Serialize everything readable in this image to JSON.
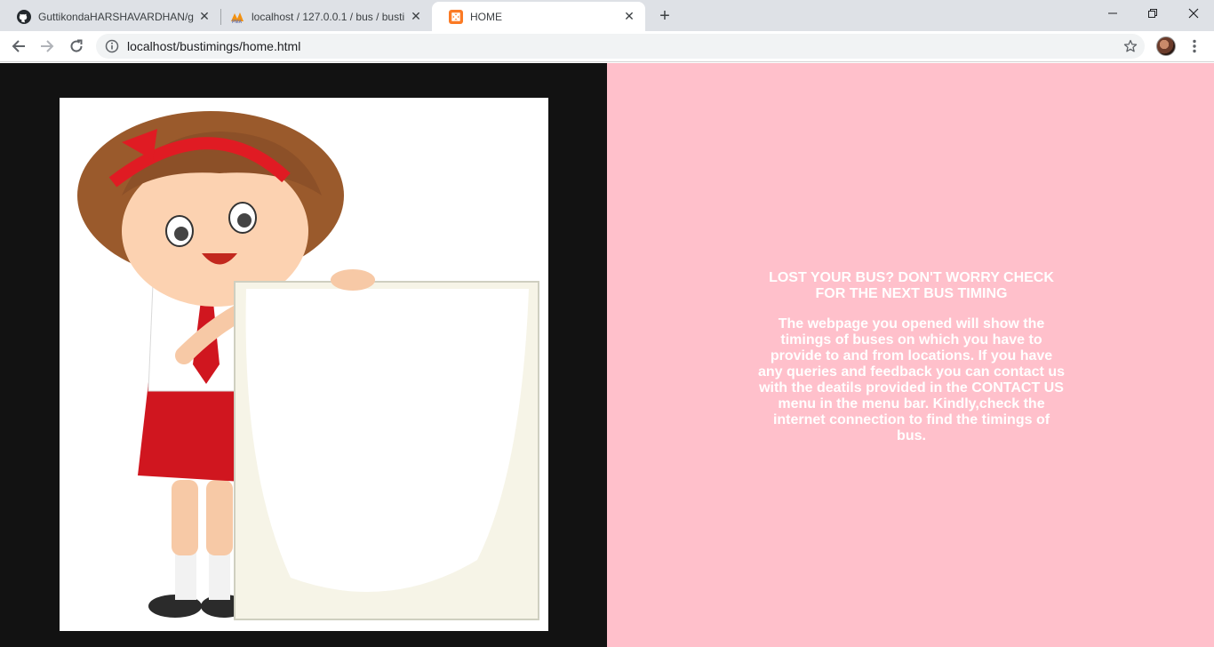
{
  "browser": {
    "tabs": [
      {
        "title": "GuttikondaHARSHAVARDHAN/g",
        "favicon": "github-icon",
        "active": false
      },
      {
        "title": "localhost / 127.0.0.1 / bus / busti",
        "favicon": "phpmyadmin-icon",
        "active": false
      },
      {
        "title": "HOME",
        "favicon": "xampp-icon",
        "active": true
      }
    ],
    "new_tab_symbol": "+",
    "close_symbol": "✕",
    "url": "localhost/bustimings/home.html"
  },
  "page": {
    "left_background": "#121212",
    "right_background": "#ffc0cb",
    "headline": "LOST YOUR BUS? DON'T WORRY CHECK FOR THE NEXT BUS TIMING",
    "body": "The webpage you opened will show the timings of buses on which you have to provide to and from locations. If you have any queries and feedback you can contact us with the deatils provided in the CONTACT US menu in the menu bar. Kindly,check the internet connection to find the timings of bus.",
    "image": "cartoon-girl-holding-blank-board"
  }
}
